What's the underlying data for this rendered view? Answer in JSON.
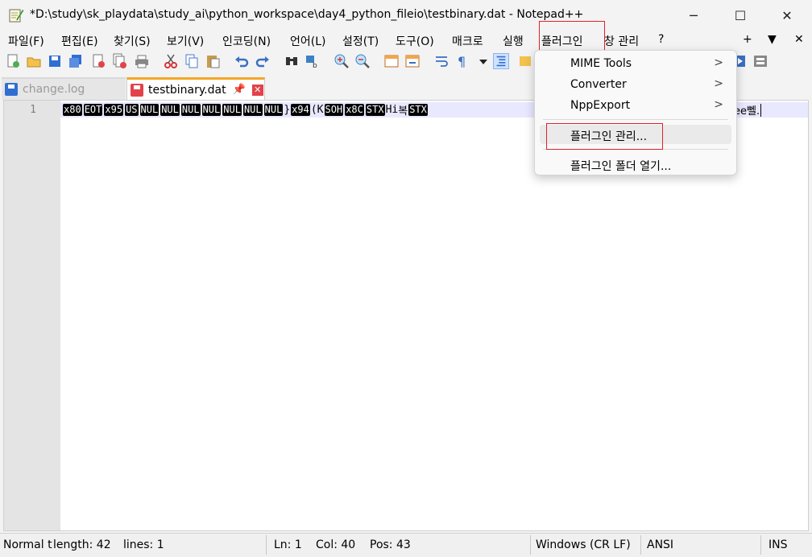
{
  "window": {
    "title": "*D:\\study\\sk_playdata\\study_ai\\python_workspace\\day4_python_fileio\\testbinary.dat - Notepad++",
    "minimize": "─",
    "maximize": "☐",
    "close": "✕"
  },
  "menu": {
    "items": [
      "파일(F)",
      "편집(E)",
      "찾기(S)",
      "보기(V)",
      "인코딩(N)",
      "언어(L)",
      "설정(T)",
      "도구(O)",
      "매크로",
      "실행",
      "플러그인",
      "창 관리",
      "?"
    ],
    "right_plus": "+",
    "right_arrow": "▼",
    "right_close": "✕"
  },
  "tabs": [
    {
      "label": "change.log",
      "active": false
    },
    {
      "label": "testbinary.dat",
      "active": true,
      "pin": "📌",
      "close": "✕"
    }
  ],
  "editor": {
    "line_number": "1",
    "segments": [
      {
        "t": "x80",
        "c": true
      },
      {
        "t": "EOT",
        "c": true
      },
      {
        "t": "x95",
        "c": true
      },
      {
        "t": "US",
        "c": true
      },
      {
        "t": "NUL",
        "c": true
      },
      {
        "t": "NUL",
        "c": true
      },
      {
        "t": "NUL",
        "c": true
      },
      {
        "t": "NUL",
        "c": true
      },
      {
        "t": "NUL",
        "c": true
      },
      {
        "t": "NUL",
        "c": true
      },
      {
        "t": "NUL",
        "c": true
      },
      {
        "t": "}",
        "c": false
      },
      {
        "t": "x94",
        "c": true
      },
      {
        "t": "(",
        "c": false
      },
      {
        "t": "K",
        "c": false
      },
      {
        "t": "SOH",
        "c": true
      },
      {
        "t": "x8C",
        "c": true
      },
      {
        "t": "STX",
        "c": true
      },
      {
        "t": "Hi",
        "c": false
      },
      {
        "t": "복",
        "c": false
      },
      {
        "t": "STX",
        "c": true
      }
    ],
    "tail_text": "ee뻴."
  },
  "plugin_menu": {
    "items": [
      {
        "label": "MIME Tools",
        "submenu": true
      },
      {
        "label": "Converter",
        "submenu": true
      },
      {
        "label": "NppExport",
        "submenu": true
      },
      {
        "label": "플러그인 관리...",
        "submenu": false
      },
      {
        "label": "플러그인 폴더 열기...",
        "submenu": false
      }
    ],
    "arrow": ">"
  },
  "status": {
    "mode": "Normal t",
    "length": "length: 42",
    "lines": "lines: 1",
    "ln": "Ln: 1",
    "col": "Col: 40",
    "pos": "Pos: 43",
    "eol": "Windows (CR LF)",
    "encoding": "ANSI",
    "ins": "INS"
  },
  "colors": {
    "highlight_box": "#e0202a",
    "tab_accent": "#f5a623",
    "control_char_bg": "#000000"
  }
}
